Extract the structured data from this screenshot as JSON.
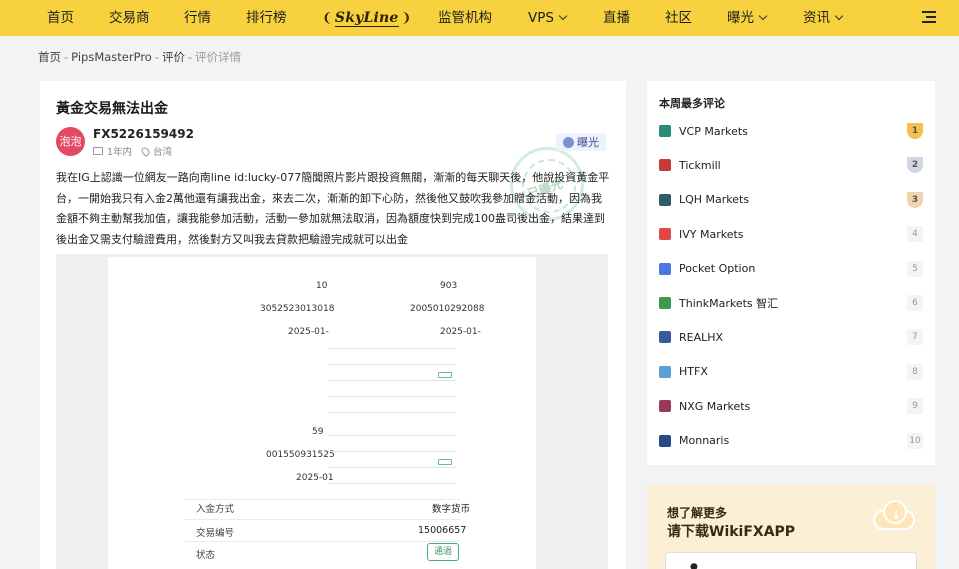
{
  "nav": {
    "items": [
      "首页",
      "交易商",
      "行情",
      "排行榜"
    ],
    "logo": "SkyLine",
    "items_right": [
      {
        "label": "监管机构",
        "caret": false
      },
      {
        "label": "VPS",
        "caret": true
      },
      {
        "label": "直播",
        "caret": false
      },
      {
        "label": "社区",
        "caret": false
      },
      {
        "label": "曝光",
        "caret": true
      },
      {
        "label": "资讯",
        "caret": true
      }
    ]
  },
  "breadcrumb": [
    "首页",
    "PipsMasterPro",
    "评价",
    "评价详情"
  ],
  "post": {
    "title": "黃金交易無法出金",
    "avatar_text": "泡泡",
    "username": "FX5226159492",
    "duration": "1年内",
    "location": "台湾",
    "badge": "曝光",
    "body": "我在IG上認識一位網友一路向南line id:lucky-077簡聞照片影片跟投資無關，漸漸的每天聊天後，他說投資黃金平台，一開始我只有入金2萬他還有讓我出金，來去二次，漸漸的卸下心防，然後他又鼓吹我參加贈金活動，因為我金額不夠主動幫我加值，讓我能參加活動，活動一參加就無法取消，因為額度快到完成100盎司後出金，結果達到後出金又需支付驗證費用，然後對方又叫我去貸款把驗證完成就可以出金"
  },
  "receipt": {
    "left": {
      "amount": "10",
      "account": "3052523013018",
      "date": "2025-01-"
    },
    "right": {
      "amount": "903",
      "account": "2005010292088",
      "date": "2025-01-"
    },
    "left2": {
      "amount": "59",
      "account": "001550931525",
      "date": "2025-01"
    },
    "detail_rows": [
      "入金方式",
      "交易编号",
      "状态"
    ],
    "detail_values": [
      "数字货币",
      "15006657",
      "通過"
    ]
  },
  "sidebar": {
    "title": "本周最多评论",
    "brokers": [
      {
        "name": "VCP Markets",
        "rank": "1",
        "color": "#2a8a7a",
        "medal": "#f4c150"
      },
      {
        "name": "Tickmill",
        "rank": "2",
        "color": "#c83a3a",
        "medal": "#cfd6e4"
      },
      {
        "name": "LQH Markets",
        "rank": "3",
        "color": "#2e5e6a",
        "medal": "#f2d3ad"
      },
      {
        "name": "IVY Markets",
        "rank": "4",
        "color": "#e04848"
      },
      {
        "name": "Pocket Option",
        "rank": "5",
        "color": "#4a78e0"
      },
      {
        "name": "ThinkMarkets 智汇",
        "rank": "6",
        "color": "#3c9a50"
      },
      {
        "name": "REALHX",
        "rank": "7",
        "color": "#3a5a9a"
      },
      {
        "name": "HTFX",
        "rank": "8",
        "color": "#5aa0d8"
      },
      {
        "name": "NXG Markets",
        "rank": "9",
        "color": "#9a3a5a"
      },
      {
        "name": "Monnaris",
        "rank": "10",
        "color": "#2a4a8a"
      }
    ]
  },
  "promo": {
    "line1": "想了解更多",
    "line2": "请下载WikiFXAPP"
  }
}
